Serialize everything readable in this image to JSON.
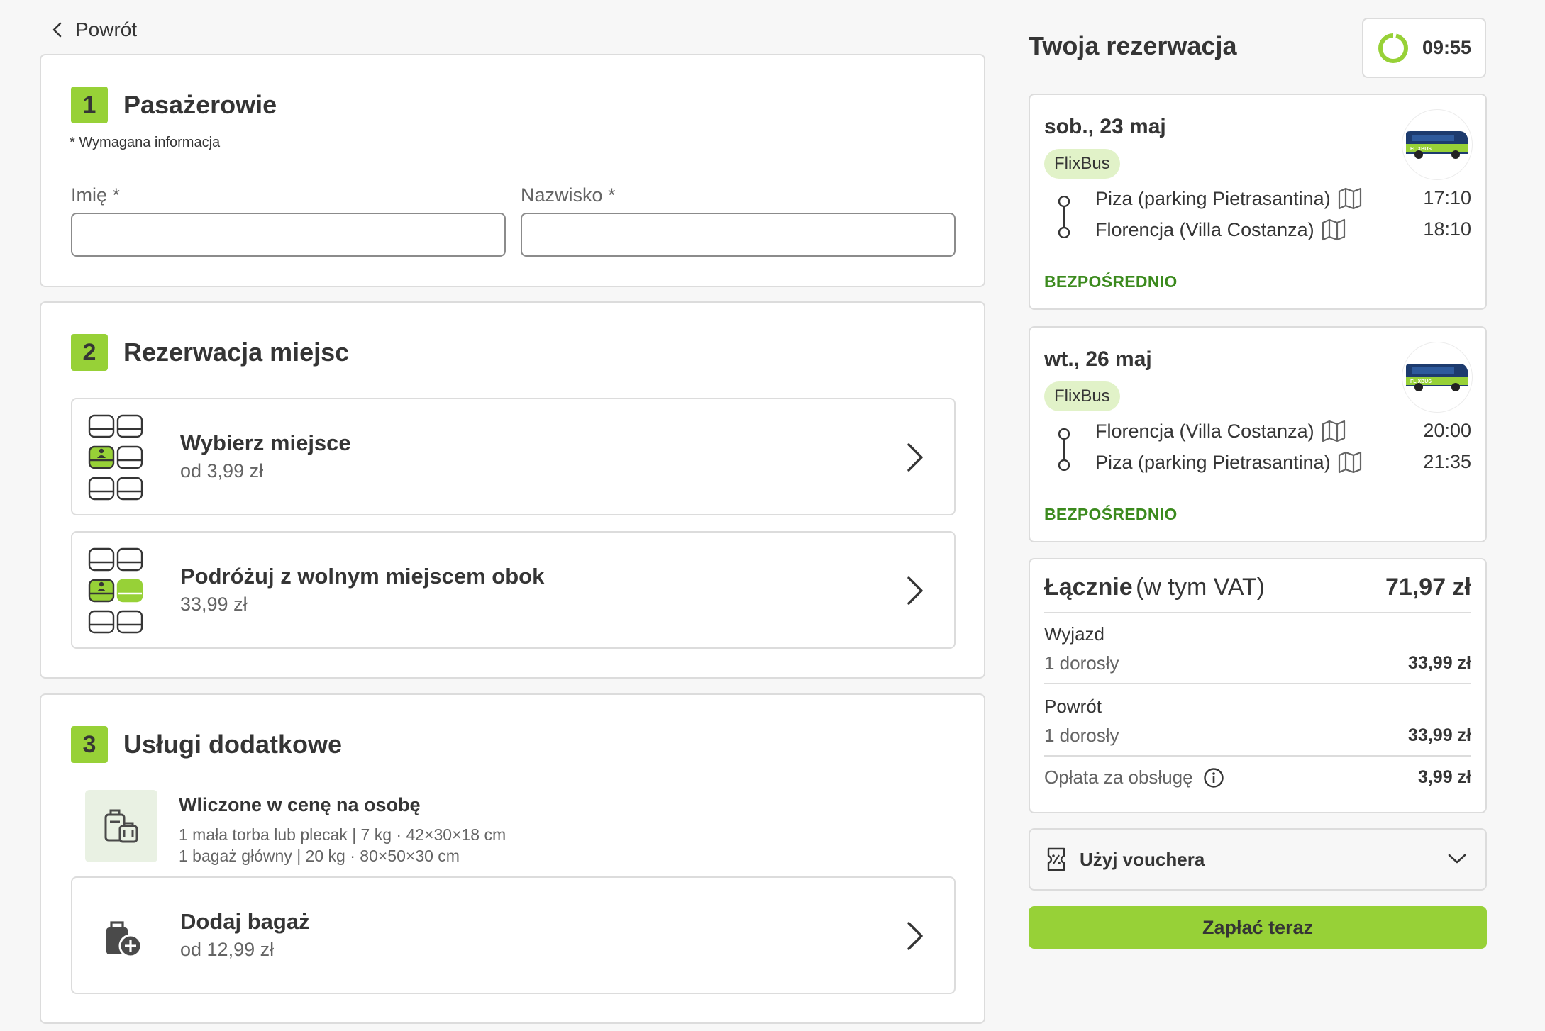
{
  "nav": {
    "back_label": "Powrót"
  },
  "passengers": {
    "step": "1",
    "title": "Pasażerowie",
    "required_note": "* Wymagana informacja",
    "first_name_label": "Imię *",
    "first_name_value": "",
    "last_name_label": "Nazwisko *",
    "last_name_value": ""
  },
  "seats": {
    "step": "2",
    "title": "Rezerwacja miejsc",
    "options": [
      {
        "title": "Wybierz miejsce",
        "price": "od 3,99 zł"
      },
      {
        "title": "Podróżuj z wolnym miejscem obok",
        "price": "33,99 zł"
      }
    ]
  },
  "extras": {
    "step": "3",
    "title": "Usługi dodatkowe",
    "included_title": "Wliczone w cenę na osobę",
    "included_lines": [
      "1 mała torba lub plecak | 7 kg · 42×30×18 cm",
      "1 bagaż główny | 20 kg · 80×50×30 cm"
    ],
    "add_bag_title": "Dodaj bagaż",
    "add_bag_price": "od 12,99 zł"
  },
  "booking": {
    "title": "Twoja rezerwacja",
    "timer": "09:55",
    "trips": [
      {
        "date": "sob., 23 maj",
        "brand": "FlixBus",
        "from": "Piza (parking Pietrasantina)",
        "from_time": "17:10",
        "to": "Florencja (Villa Costanza)",
        "to_time": "18:10",
        "tag": "BEZPOŚREDNIO"
      },
      {
        "date": "wt., 26 maj",
        "brand": "FlixBus",
        "from": "Florencja (Villa Costanza)",
        "from_time": "20:00",
        "to": "Piza (parking Pietrasantina)",
        "to_time": "21:35",
        "tag": "BEZPOŚREDNIO"
      }
    ],
    "bus_logo_text": "FLIXBUS",
    "total": {
      "label": "Łącznie",
      "vat": "(w tym VAT)",
      "amount": "71,97 zł",
      "outbound_label": "Wyjazd",
      "outbound_pax": "1 dorosły",
      "outbound_price": "33,99 zł",
      "return_label": "Powrót",
      "return_pax": "1 dorosły",
      "return_price": "33,99 zł",
      "fee_label": "Opłata za obsługę",
      "fee_price": "3,99 zł"
    },
    "voucher_label": "Użyj vouchera",
    "pay_label": "Zapłać teraz"
  },
  "colors": {
    "accent": "#97d137",
    "direct": "#3b8a1d",
    "badge_bg": "#e1f2c8",
    "bus_body": "#1d3b6e"
  }
}
